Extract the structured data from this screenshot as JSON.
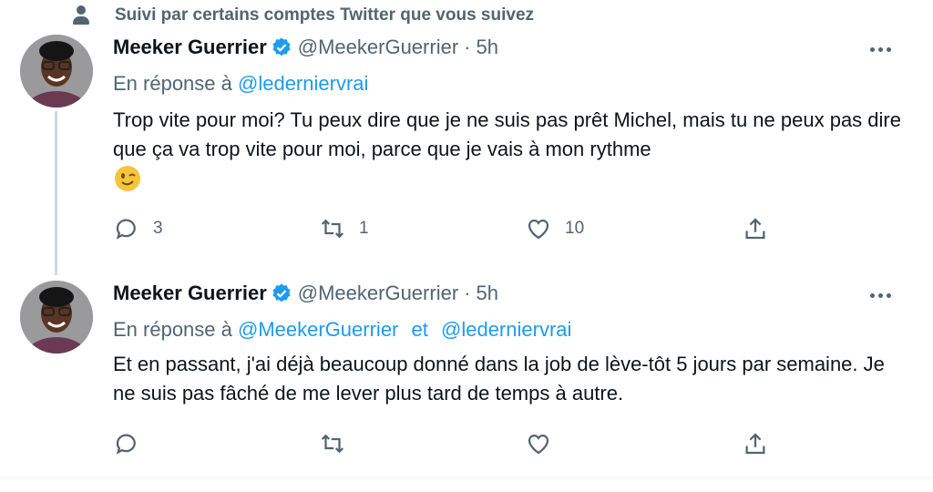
{
  "social_context": "Suivi par certains comptes Twitter que vous suivez",
  "icons": {
    "social": "person-icon",
    "verified": "verified-badge-icon",
    "more": "more-icon",
    "reply": "reply-icon",
    "retweet": "retweet-icon",
    "like": "like-icon",
    "share": "share-icon",
    "emoji": "winking-face-emoji"
  },
  "colors": {
    "accent": "#1d9bf0",
    "muted": "#536471",
    "text": "#0f1419",
    "thread_line": "#cfd9de"
  },
  "tweets": [
    {
      "display_name": "Meeker Guerrier",
      "handle": "@MeekerGuerrier",
      "separator": "·",
      "time": "5h",
      "reply_prefix": "En réponse à",
      "reply_mentions": [
        "@ledernier­vrai"
      ],
      "reply_joiner": "",
      "text": "Trop vite pour moi? Tu peux dire que je ne suis pas prêt Michel, mais tu ne peux pas dire que ça va trop vite pour moi, parce que je vais à mon rythme",
      "replies": "3",
      "retweets": "1",
      "likes": "10"
    },
    {
      "display_name": "Meeker Guerrier",
      "handle": "@MeekerGuerrier",
      "separator": "·",
      "time": "5h",
      "reply_prefix": "En réponse à",
      "reply_mentions": [
        "@MeekerGuerrier",
        "@ledernier­vrai"
      ],
      "reply_joiner": "et",
      "text": "Et en passant, j'ai déjà beaucoup donné dans la job de lève-tôt 5 jours par semaine. Je ne suis pas fâché de me lever plus tard de temps à autre.",
      "replies": "",
      "retweets": "",
      "likes": ""
    }
  ]
}
